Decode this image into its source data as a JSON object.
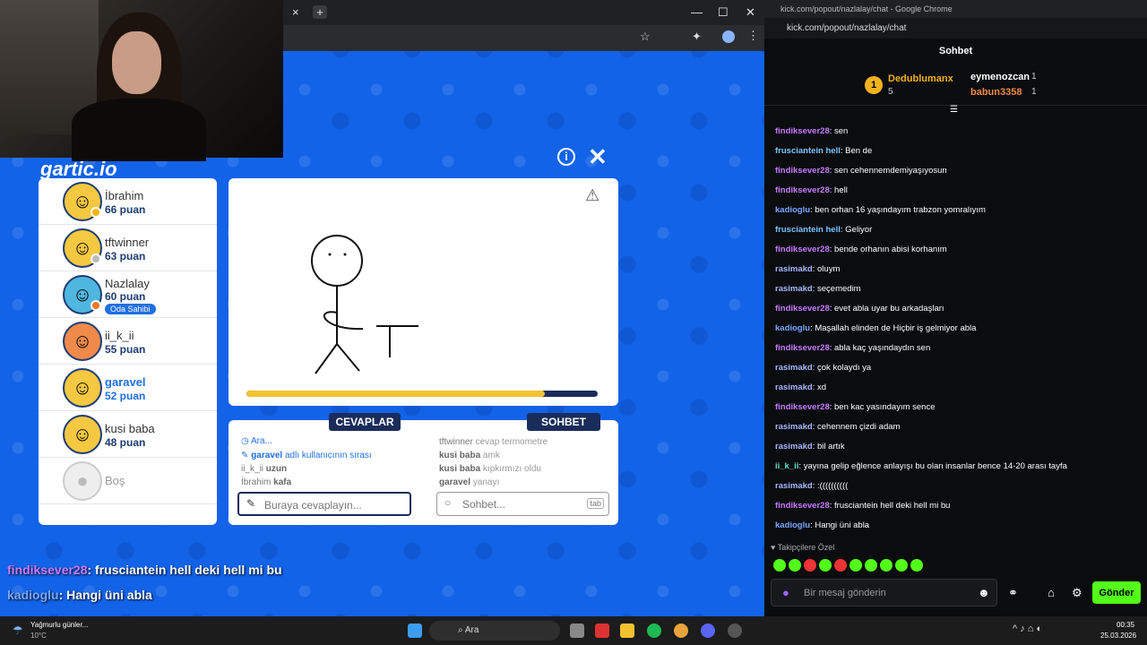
{
  "browser": {
    "left_win_buttons": {
      "close": "×",
      "new": "+"
    },
    "right_title": "kick.com/popout/nazlalay/chat - Google Chrome",
    "url": "kick.com/popout/nazlalay/chat"
  },
  "game": {
    "players": [
      {
        "name": "İbrahim",
        "points": "66 puan",
        "status_color": "#f5b400"
      },
      {
        "name": "tftwinner",
        "points": "63 puan",
        "status_color": "#bbbbbb"
      },
      {
        "name": "Nazlalay",
        "points": "60 puan",
        "status_color": "#f07a22",
        "badge": "Oda Sahibi"
      },
      {
        "name": "ii_k_ii",
        "points": "55 puan"
      },
      {
        "name": "garavel",
        "points": "52 puan",
        "drawing": true
      },
      {
        "name": "kusi baba",
        "points": "48 puan"
      },
      {
        "name": "Boş"
      }
    ],
    "timer_progress": 0.85,
    "answers_title": "CEVAPLAR",
    "chat_title": "SOHBET",
    "answers": {
      "searching": "Ara...",
      "turn_user": "garavel",
      "turn_text": "adlı kullanıcının sırası",
      "lines": [
        {
          "user": "ii_k_ii",
          "text": "uzun"
        },
        {
          "user": "İbrahim",
          "text": "kafa"
        }
      ]
    },
    "chat": {
      "lines": [
        {
          "user": "tftwinner",
          "text": "cevap termometre"
        },
        {
          "user": "kusi baba",
          "text": "amk"
        },
        {
          "user": "kusi baba",
          "text": "kıpkırmızı oldu"
        },
        {
          "user": "garavel",
          "text": "yanayı"
        }
      ]
    },
    "answer_placeholder": "Buraya cevaplayın...",
    "chat_placeholder": "Sohbet...",
    "tab_hint": "tab",
    "overlay_chat": [
      {
        "user": "findiksever28",
        "text": ": frusciantein hell deki hell mi bu"
      },
      {
        "user": "kadioglu",
        "text": ": Hangi üni abla"
      }
    ]
  },
  "kick": {
    "header": "Sohbet",
    "leaderboard": [
      {
        "rank": "1",
        "name": "Dedublumanx",
        "count": "5"
      },
      {
        "name": "eymenozcan",
        "count": "1"
      },
      {
        "name": "babun3358",
        "count": "1"
      }
    ],
    "messages": [
      {
        "user": "findiksever28",
        "color": "#c77dff",
        "text": "sen"
      },
      {
        "user": "frusciantein hell",
        "color": "#7cc4ff",
        "text": "Ben de"
      },
      {
        "user": "findiksever28",
        "color": "#c77dff",
        "text": "sen cehennemdemiyaşıyosun"
      },
      {
        "user": "findiksever28",
        "color": "#c77dff",
        "text": "hell"
      },
      {
        "user": "kadioglu",
        "color": "#7aa7ff",
        "text": "ben orhan 16 yaşındayım trabzon yomralıyım"
      },
      {
        "user": "frusciantein hell",
        "color": "#7cc4ff",
        "text": "Geliyor"
      },
      {
        "user": "findiksever28",
        "color": "#c77dff",
        "text": "bende orhanın abisi korhanım"
      },
      {
        "user": "rasimakd",
        "color": "#a7b8ff",
        "text": "oluym"
      },
      {
        "user": "rasimakd",
        "color": "#a7b8ff",
        "text": "seçemedim"
      },
      {
        "user": "findiksever28",
        "color": "#c77dff",
        "text": "evet abla uyar bu arkadaşları"
      },
      {
        "user": "kadioglu",
        "color": "#7aa7ff",
        "text": "Maşallah elinden de Hiçbir iş gelmiyor abla"
      },
      {
        "user": "findiksever28",
        "color": "#c77dff",
        "text": "abla kaç yaşındaydın sen"
      },
      {
        "user": "rasimakd",
        "color": "#a7b8ff",
        "text": "çok kolaydı ya"
      },
      {
        "user": "rasimakd",
        "color": "#a7b8ff",
        "text": "xd"
      },
      {
        "user": "findiksever28",
        "color": "#c77dff",
        "text": "ben kac yasındayım sence"
      },
      {
        "user": "rasimakd",
        "color": "#a7b8ff",
        "text": "cehennem çizdi adam"
      },
      {
        "user": "rasimakd",
        "color": "#a7b8ff",
        "text": "bil artık"
      },
      {
        "user": "ii_k_ii",
        "color": "#5fe0c4",
        "text": "yayına gelip eğlence anlayışı bu olan insanlar bence 14-20 arası tayfa"
      },
      {
        "user": "rasimakd",
        "color": "#a7b8ff",
        "text": ":(((((((((("
      },
      {
        "user": "findiksever28",
        "color": "#c77dff",
        "text": "frusciantein hell deki hell mi bu"
      },
      {
        "user": "kadioglu",
        "color": "#7aa7ff",
        "text": "Hangi üni abla"
      }
    ],
    "followers_only": "Takipçilere Özel",
    "input_placeholder": "Bir mesaj gönderin",
    "send": "Gönder",
    "accent": "#53fc18"
  },
  "taskbar": {
    "weather_title": "Yağmurlu günler...",
    "weather_temp": "10°C",
    "search": "Ara",
    "time": "00:35",
    "date": "25.03.2026"
  }
}
